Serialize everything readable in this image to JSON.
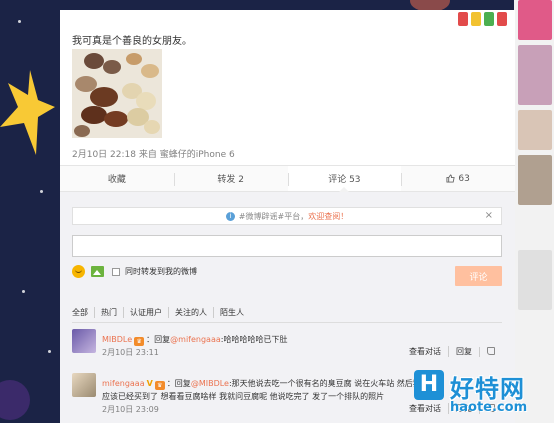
{
  "post": {
    "text": "我可真是个善良的女朋友。",
    "date": "2月10日 22:18",
    "source_prefix": "来自",
    "source": "蜜蜂仔的iPhone 6"
  },
  "actions": {
    "favorite": "收藏",
    "repost": "转发 2",
    "comment": "评论 53",
    "like": "63"
  },
  "notice": {
    "text": "#微博辟谣#平台，",
    "link": "欢迎查阅！",
    "close": "×"
  },
  "composer": {
    "input_value": "",
    "repost_checkbox_label": "同时转发到我的微博",
    "submit_label": "评论"
  },
  "filters": [
    "全部",
    "热门",
    "认证用户",
    "关注的人",
    "陌生人"
  ],
  "comments": [
    {
      "username": "MIBDLe",
      "reply_prefix": "：回复",
      "mention": "@mifengaaa",
      "text": ":哈哈哈哈哈已下肚",
      "time": "2月10日 23:11",
      "actions": [
        "查看对话",
        "回复"
      ]
    },
    {
      "username": "mifengaaa",
      "badge": "V",
      "reply_prefix": "：回复",
      "mention": "@MIBDLe",
      "text": ":那天他说去吃一个很有名的臭豆腐 说在火车站 然后我说我",
      "text2": "应该已经买到了 想看看豆腐啥样 我就问豆腐呢 他说吃完了 发了一个排队的照片",
      "time": "2月10日 23:09",
      "actions": [
        "查看对话",
        "回复"
      ]
    }
  ],
  "watermark": {
    "logo": "H",
    "text": "好特网",
    "url": "haote.com"
  },
  "colors": {
    "accent": "#eb7350",
    "submit_disabled": "#ffc09f",
    "background": "#1b2346"
  }
}
